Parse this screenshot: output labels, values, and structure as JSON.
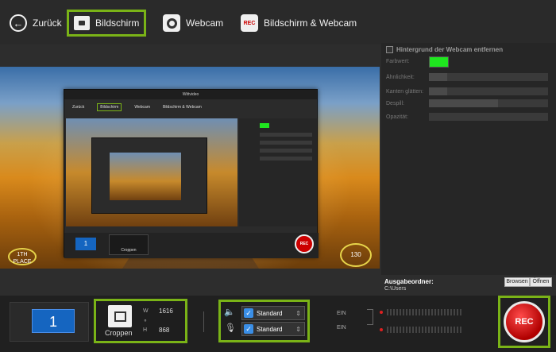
{
  "nav": {
    "back_label": "Zurück",
    "screen_label": "Bildschirm",
    "webcam_label": "Webcam",
    "both_label": "Bildschirm & Webcam",
    "rec_icon_text": "REC"
  },
  "preview": {
    "place_badge": "1TH PLACE",
    "speed": "130",
    "inner": {
      "title": "Wittvideo",
      "nav_back": "Zurück",
      "nav_screen": "Bildschirm",
      "nav_webcam": "Webcam",
      "nav_both": "Bildschirm & Webcam",
      "monitor": "1",
      "crop": "Croppen",
      "rec": "REC"
    }
  },
  "webcam_panel": {
    "remove_bg_label": "Hintergrund der Webcam entfernen",
    "color_label": "Farbwert:",
    "color_value": "#1fe61f",
    "similarity_label": "Ähnlichkeit:",
    "similarity": 0.15,
    "smoothing_label": "Kanten glätten:",
    "smoothing": 0.15,
    "spill_label": "Despill:",
    "spill": 0.58,
    "opacity_label": "Opazität:",
    "opacity": 0.0
  },
  "output": {
    "label": "Ausgabeordner:",
    "path": "C:\\Users",
    "browse_label": "Browsen",
    "open_label": "Öffnen"
  },
  "controls": {
    "monitor_number": "1",
    "crop_label": "Croppen",
    "w_label": "W",
    "w_value": "1616",
    "h_label": "H",
    "h_value": "868",
    "link_icon": "link-icon",
    "speaker_label": "Standard",
    "mic_label": "Standard",
    "speaker_state": "EIN",
    "mic_state": "EIN",
    "rec_label": "REC"
  },
  "colors": {
    "highlight": "#7ab317",
    "accent_blue": "#1565c0",
    "rec_red": "#c00000",
    "chroma_green": "#1fe61f"
  }
}
